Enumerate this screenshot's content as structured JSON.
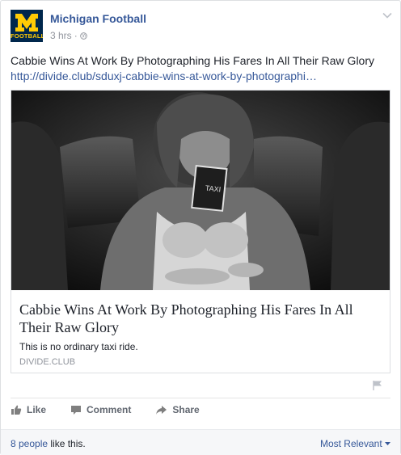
{
  "post": {
    "page_name": "Michigan Football",
    "logo_wordmark": "FOOTBALL",
    "timestamp": "3 hrs",
    "separator": "·",
    "message": "Cabbie Wins At Work By Photographing His Fares In All Their Raw Glory",
    "link_url": "http://divide.club/sduxj-cabbie-wins-at-work-by-photographi…",
    "attachment": {
      "title": "Cabbie Wins At Work By Photographing His Fares In All Their Raw Glory",
      "description": "This is no ordinary taxi ride.",
      "domain": "DIVIDE.CLUB"
    }
  },
  "actions": {
    "like": "Like",
    "comment": "Comment",
    "share": "Share"
  },
  "footer": {
    "likes_count": "8 people",
    "likes_suffix": " like this.",
    "sort_label": "Most Relevant"
  },
  "colors": {
    "link_blue": "#365899",
    "logo_navy": "#00274c",
    "logo_maize": "#ffcb05",
    "muted_gray": "#90949c"
  },
  "icons": [
    "block-m-logo",
    "globe-icon",
    "chevron-down-icon",
    "flag-icon",
    "thumbs-up-icon",
    "comment-icon",
    "share-icon",
    "caret-down-icon"
  ]
}
